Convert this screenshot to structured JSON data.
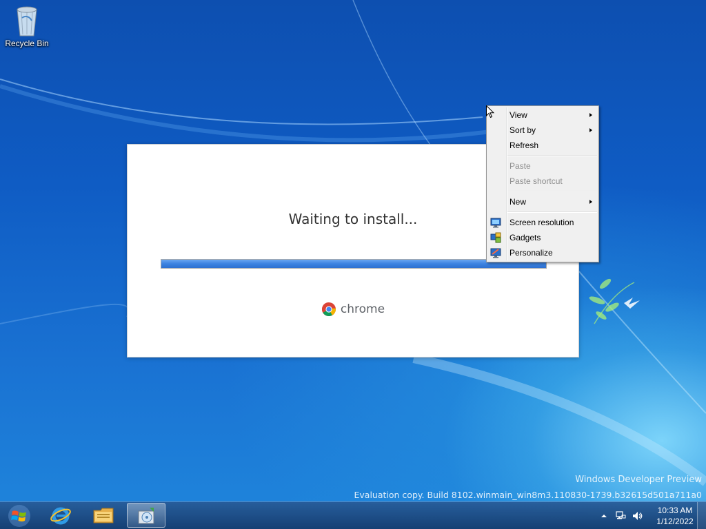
{
  "desktop": {
    "icons": [
      {
        "label": "Recycle Bin",
        "icon": "recycle-bin-icon"
      }
    ]
  },
  "installer": {
    "status": "Waiting to install...",
    "progress": 1.0,
    "brand": "chrome",
    "brand_icon": "chrome-logo-icon"
  },
  "context_menu": {
    "items": [
      {
        "label": "View",
        "submenu": true,
        "disabled": false
      },
      {
        "label": "Sort by",
        "submenu": true,
        "disabled": false
      },
      {
        "label": "Refresh",
        "submenu": false,
        "disabled": false
      },
      {
        "label": "Paste",
        "submenu": false,
        "disabled": true
      },
      {
        "label": "Paste shortcut",
        "submenu": false,
        "disabled": true
      },
      {
        "label": "New",
        "submenu": true,
        "disabled": false
      },
      {
        "label": "Screen resolution",
        "submenu": false,
        "disabled": false,
        "icon": "screen-resolution-icon"
      },
      {
        "label": "Gadgets",
        "submenu": false,
        "disabled": false,
        "icon": "gadgets-icon"
      },
      {
        "label": "Personalize",
        "submenu": false,
        "disabled": false,
        "icon": "personalize-icon"
      }
    ]
  },
  "watermark": {
    "line1": "Windows Developer Preview",
    "line2": "Evaluation copy. Build 8102.winmain_win8m3.110830-1739.b32615d501a711a0"
  },
  "taskbar": {
    "start_icon": "windows-start-icon",
    "pinned": [
      {
        "icon": "internet-explorer-icon",
        "active": false
      },
      {
        "icon": "file-explorer-icon",
        "active": false
      },
      {
        "icon": "installer-app-icon",
        "active": true
      }
    ],
    "tray": {
      "icons": [
        "show-hidden-icons-arrow",
        "network-icon",
        "volume-icon"
      ],
      "time": "10:33 AM",
      "date": "1/12/2022"
    }
  },
  "colors": {
    "progress_fill": "#3c82e0",
    "desktop_blue": "#0f5cc4",
    "menu_bg": "#f0f0f0"
  }
}
